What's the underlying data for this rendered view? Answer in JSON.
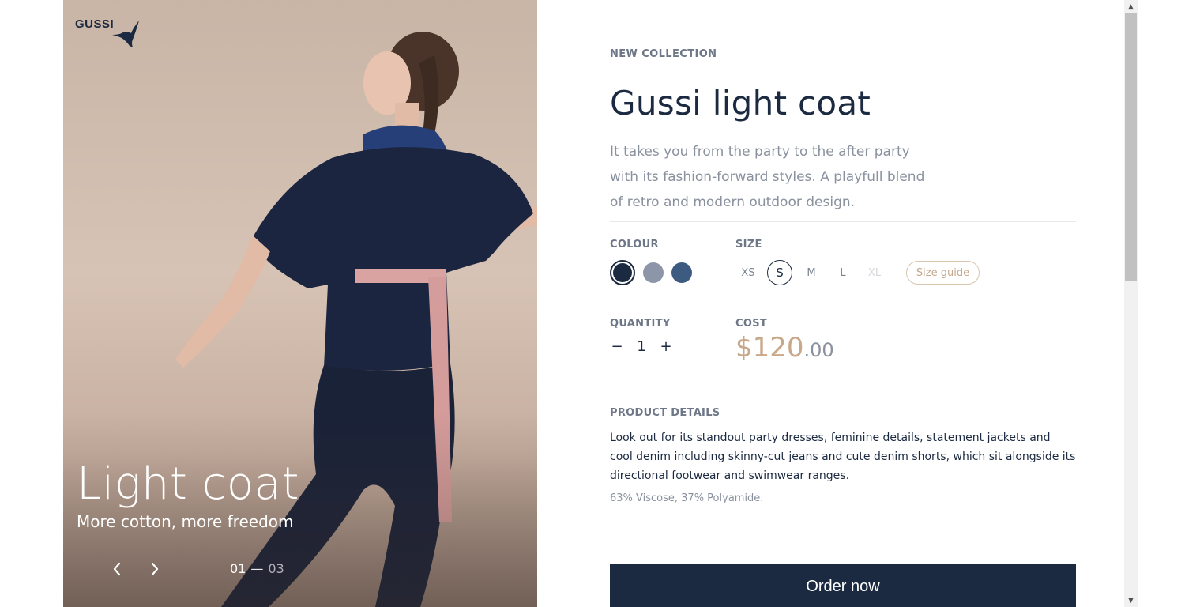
{
  "brand": {
    "name": "GUSSI"
  },
  "hero": {
    "title": "Light coat",
    "subtitle": "More cotton, more freedom",
    "pager": {
      "current": "01",
      "separator": "—",
      "total": "03"
    }
  },
  "product": {
    "eyebrow": "NEW COLLECTION",
    "title": "Gussi light coat",
    "description": "It takes you from the party to the after party with its fashion-forward styles. A playfull blend of retro and modern outdoor design.",
    "colour_label": "COLOUR",
    "colours": [
      "#1b2a40",
      "#8d96a8",
      "#3d5a80"
    ],
    "selected_colour": "#1b2a40",
    "size_label": "SIZE",
    "sizes": [
      {
        "label": "XS",
        "state": "normal"
      },
      {
        "label": "S",
        "state": "active"
      },
      {
        "label": "M",
        "state": "normal"
      },
      {
        "label": "L",
        "state": "normal"
      },
      {
        "label": "XL",
        "state": "disabled"
      }
    ],
    "size_guide": "Size guide",
    "quantity_label": "QUANTITY",
    "quantity": {
      "decrement": "−",
      "value": "1",
      "increment": "+"
    },
    "cost_label": "COST",
    "price": {
      "main": "$120",
      "cents": ".00"
    },
    "details_label": "PRODUCT DETAILS",
    "details_text": "Look out for its standout party dresses, feminine details, statement jackets and cool denim including skinny-cut jeans and cute denim shorts, which sit alongside its directional footwear and swimwear ranges.",
    "material": "63% Viscose, 37% Polyamide.",
    "order_button": "Order now"
  },
  "colors": {
    "navy": "#1b2a40",
    "accent": "#c9a88a",
    "muted": "#8a919e"
  }
}
